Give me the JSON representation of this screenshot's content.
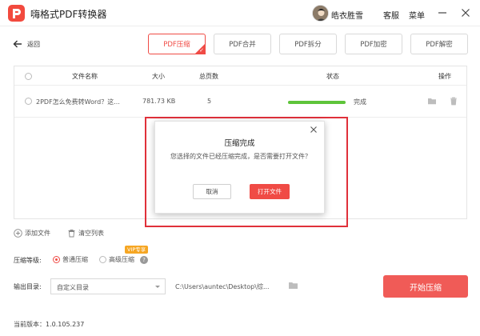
{
  "titlebar": {
    "app_title": "嗨格式PDF转换器",
    "username": "皓衣胜雪",
    "service": "客服",
    "menu": "菜单"
  },
  "toolbar": {
    "back_label": "返回",
    "tabs": [
      {
        "label": "PDF压缩",
        "active": true
      },
      {
        "label": "PDF合并",
        "active": false
      },
      {
        "label": "PDF拆分",
        "active": false
      },
      {
        "label": "PDF加密",
        "active": false
      },
      {
        "label": "PDF解密",
        "active": false
      }
    ]
  },
  "table": {
    "headers": {
      "name": "文件名称",
      "size": "大小",
      "pages": "总页数",
      "status": "状态",
      "actions": "操作"
    },
    "rows": [
      {
        "name": "2PDF怎么免费转Word？这...",
        "size": "781.73 KB",
        "pages": "5",
        "progress": 1.0,
        "status": "完成"
      }
    ]
  },
  "dialog": {
    "title": "压缩完成",
    "message": "您选择的文件已经压缩完成，是否需要打开文件？",
    "cancel": "取消",
    "open": "打开文件"
  },
  "actions": {
    "add_file": "添加文件",
    "clear_list": "清空列表"
  },
  "compression": {
    "label": "压缩等级:",
    "options": [
      {
        "label": "普通压缩",
        "selected": true
      },
      {
        "label": "高级压缩",
        "selected": false
      }
    ],
    "vip_badge": "VIP专享"
  },
  "output": {
    "label": "输出目录:",
    "select_value": "自定义目录",
    "path": "C:\\Users\\auntec\\Desktop\\综..."
  },
  "start_button": "开始压缩",
  "version": "当前版本：1.0.105.237",
  "colors": {
    "accent": "#f04b45",
    "progress": "#5ec43a",
    "frame": "#e0303a",
    "vip": "#f6a623"
  }
}
